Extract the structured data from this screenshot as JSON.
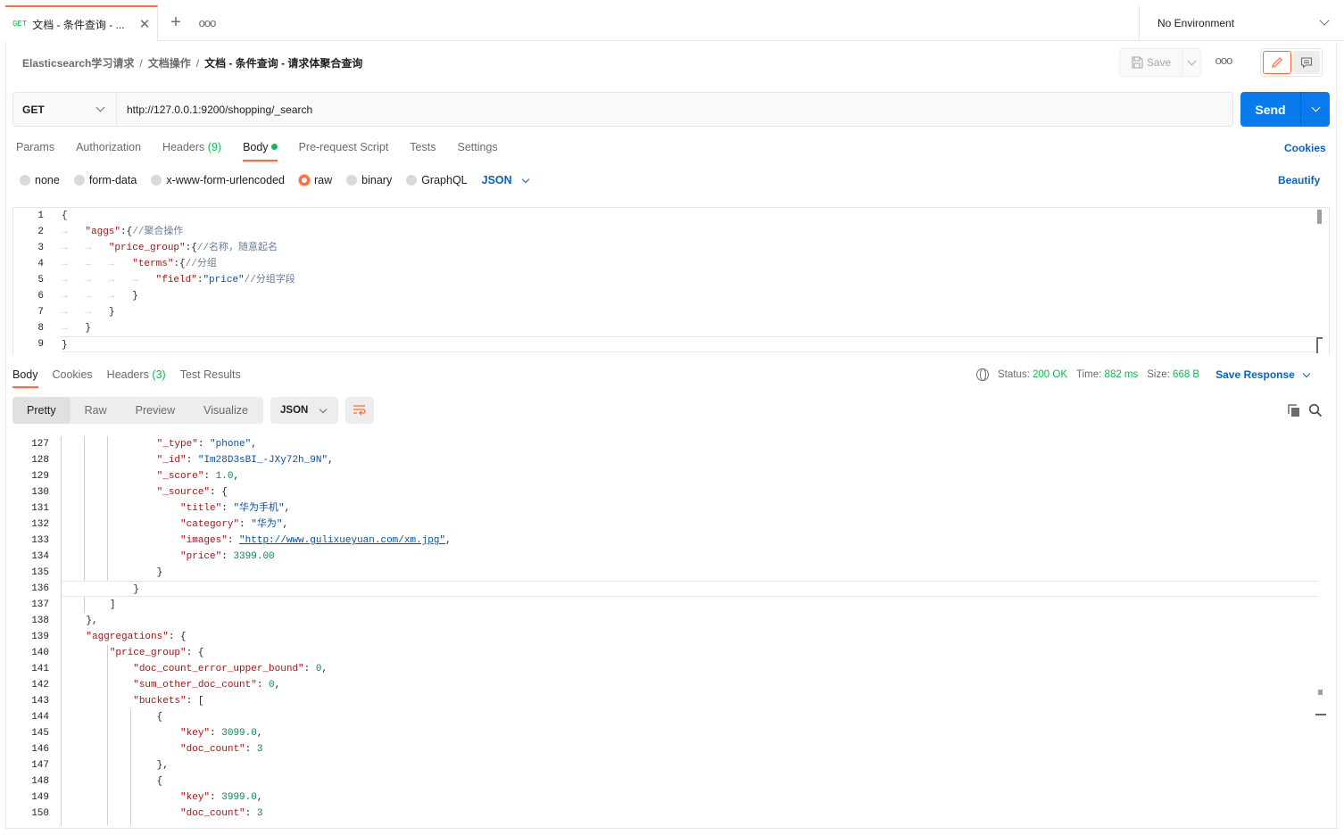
{
  "tab": {
    "method": "GET",
    "name": "文档 - 条件查询 - ...",
    "close": "✕",
    "add": "+",
    "more": "ooo"
  },
  "environment": {
    "label": "No Environment"
  },
  "breadcrumb": {
    "collection": "Elasticsearch学习请求",
    "folder": "文档操作",
    "request": "文档 - 条件查询 - 请求体聚合查询",
    "separator": "/"
  },
  "toolbar": {
    "save_label": "Save",
    "more": "ooo"
  },
  "request": {
    "method": "GET",
    "url": "http://127.0.0.1:9200/shopping/_search",
    "send_label": "Send"
  },
  "request_tabs": [
    {
      "label": "Params"
    },
    {
      "label": "Authorization"
    },
    {
      "label": "Headers",
      "count": "(9)"
    },
    {
      "label": "Body"
    },
    {
      "label": "Pre-request Script"
    },
    {
      "label": "Tests"
    },
    {
      "label": "Settings"
    }
  ],
  "cookies_label": "Cookies",
  "body_types": [
    "none",
    "form-data",
    "x-www-form-urlencoded",
    "raw",
    "binary",
    "GraphQL"
  ],
  "body_format": "JSON",
  "beautify_label": "Beautify",
  "request_body_lines": [
    "1",
    "2",
    "3",
    "4",
    "5",
    "6",
    "7",
    "8",
    "9"
  ],
  "request_body": {
    "l1": "{",
    "l2_key": "\"aggs\"",
    "l2_rest": ":{",
    "l2_comment": "//聚合操作",
    "l3_key": "\"price_group\"",
    "l3_rest": ":{",
    "l3_comment": "//名称，随意起名",
    "l4_key": "\"terms\"",
    "l4_rest": ":{",
    "l4_comment": "//分组",
    "l5_key": "\"field\"",
    "l5_colon": ":",
    "l5_val": "\"price\"",
    "l5_comment": "//分组字段",
    "l6": "}",
    "l7": "}",
    "l8": "}",
    "l9": "}"
  },
  "response_tabs": [
    {
      "label": "Body"
    },
    {
      "label": "Cookies"
    },
    {
      "label": "Headers",
      "count": "(3)"
    },
    {
      "label": "Test Results"
    }
  ],
  "response_status": {
    "status_label": "Status:",
    "status_value": "200 OK",
    "time_label": "Time:",
    "time_value": "882 ms",
    "size_label": "Size:",
    "size_value": "668 B",
    "save_response": "Save Response"
  },
  "view_modes": [
    "Pretty",
    "Raw",
    "Preview",
    "Visualize"
  ],
  "response_format": "JSON",
  "response_lines": [
    "127",
    "128",
    "129",
    "130",
    "131",
    "132",
    "133",
    "134",
    "135",
    "136",
    "137",
    "138",
    "139",
    "140",
    "141",
    "142",
    "143",
    "144",
    "145",
    "146",
    "147",
    "148",
    "149",
    "150"
  ],
  "response": {
    "r127_k": "\"_type\"",
    "r127_v": "\"phone\"",
    "r128_k": "\"_id\"",
    "r128_v": "\"Im28D3sBI_-JXy72h_9N\"",
    "r129_k": "\"_score\"",
    "r129_v": "1.0",
    "r130_k": "\"_source\"",
    "r131_k": "\"title\"",
    "r131_v": "\"华为手机\"",
    "r132_k": "\"category\"",
    "r132_v": "\"华为\"",
    "r133_k": "\"images\"",
    "r133_v": "\"http://www.gulixueyuan.com/xm.jpg\"",
    "r134_k": "\"price\"",
    "r134_v": "3399.00",
    "r139_k": "\"aggregations\"",
    "r140_k": "\"price_group\"",
    "r141_k": "\"doc_count_error_upper_bound\"",
    "r141_v": "0",
    "r142_k": "\"sum_other_doc_count\"",
    "r142_v": "0",
    "r143_k": "\"buckets\"",
    "r145_k": "\"key\"",
    "r145_v": "3099.0",
    "r146_k": "\"doc_count\"",
    "r146_v": "3",
    "r149_k": "\"key\"",
    "r149_v": "3999.0",
    "r150_k": "\"doc_count\"",
    "r150_v": "3"
  },
  "colors": {
    "accent": "#ff6c37",
    "primary": "#097bed",
    "success": "#0cbb52",
    "link": "#0a63bd"
  }
}
